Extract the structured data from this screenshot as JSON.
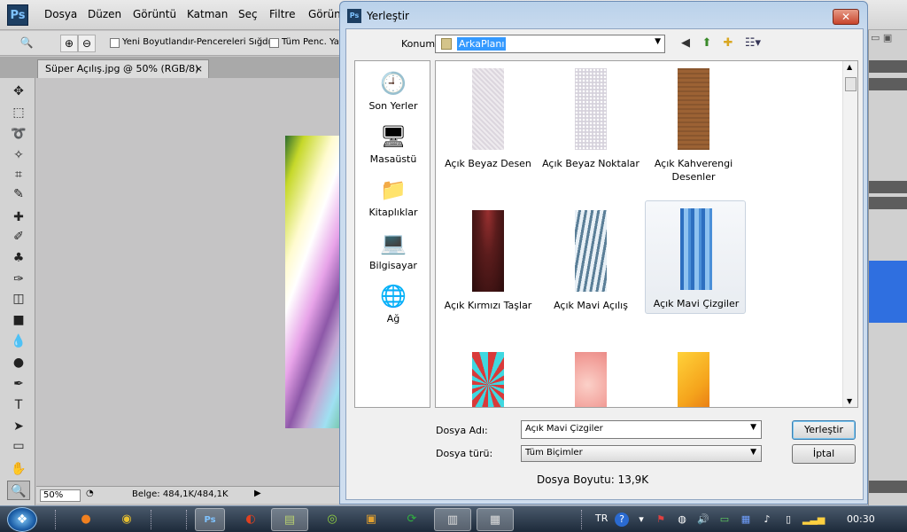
{
  "photoshop": {
    "logo": "Ps",
    "menu": [
      "Dosya",
      "Düzen",
      "Görüntü",
      "Katman",
      "Seç",
      "Filtre",
      "Görünüm"
    ],
    "options": {
      "resize_windows_label": "Yeni Boyutlandır-Pencereleri Sığdır",
      "all_windows_label": "Tüm Penc. Yak"
    },
    "document_tab": {
      "title": "Süper Açılış.jpg @ 50% (RGB/8)",
      "close": "×"
    },
    "status": {
      "zoom": "50%",
      "doc_size": "Belge: 484,1K/484,1K"
    }
  },
  "dialog": {
    "title": "Yerleştir",
    "close": "✕",
    "konum_label": "Konum:",
    "konum_value": "ArkaPlanı",
    "places": [
      {
        "label": "Son Yerler",
        "icon": "recent-places-icon"
      },
      {
        "label": "Masaüstü",
        "icon": "desktop-icon"
      },
      {
        "label": "Kitaplıklar",
        "icon": "libraries-icon"
      },
      {
        "label": "Bilgisayar",
        "icon": "computer-icon"
      },
      {
        "label": "Ağ",
        "icon": "network-icon"
      }
    ],
    "files": [
      {
        "name": "Açık Beyaz Desen",
        "color": "#dcd6de"
      },
      {
        "name": "Açık Beyaz Noktalar",
        "color": "#d6d2dc"
      },
      {
        "name": "Açık Kahverengi Desenler",
        "color": "#9c6234"
      },
      {
        "name": "Açık Kırmızı Taşlar",
        "color": "#5a1c1c"
      },
      {
        "name": "Açık Mavi Açılış",
        "color": "#5b7f98"
      },
      {
        "name": "Açık Mavi Çizgiler",
        "color": "#4a8fd8",
        "selected": true
      },
      {
        "name": "",
        "color": "#d83a3a"
      },
      {
        "name": "",
        "color": "#f2a09a"
      },
      {
        "name": "",
        "color": "#f5a41c"
      }
    ],
    "dosya_adi_label": "Dosya Adı:",
    "dosya_adi_value": "Açık Mavi Çizgiler",
    "dosya_turu_label": "Dosya türü:",
    "dosya_turu_value": "Tüm Biçimler",
    "place_button": "Yerleştir",
    "cancel_button": "İptal",
    "file_size": "Dosya Boyutu: 13,9K"
  },
  "taskbar": {
    "language": "TR",
    "clock": "00:30"
  }
}
